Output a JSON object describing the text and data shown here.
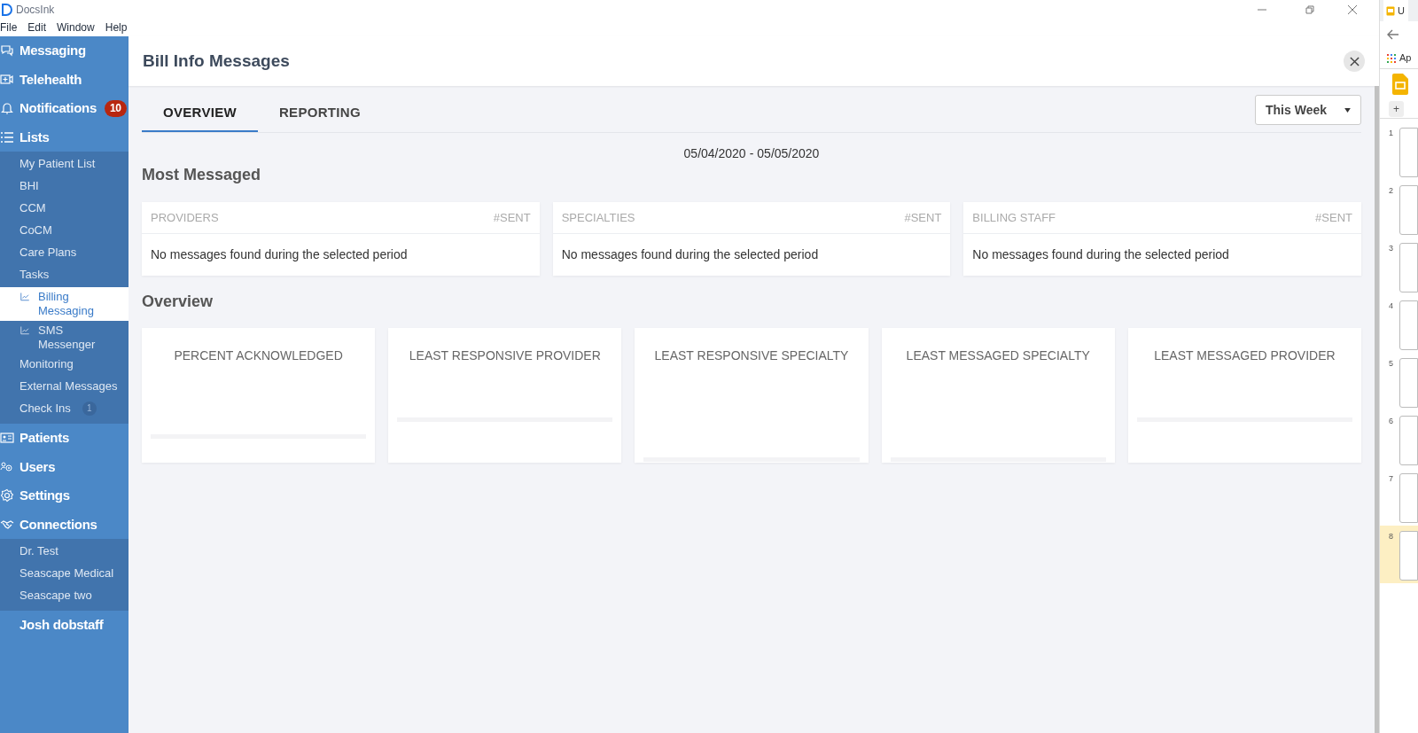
{
  "window": {
    "title": "DocsInk",
    "menu": [
      "File",
      "Edit",
      "Window",
      "Help"
    ]
  },
  "sidebar": {
    "items": [
      {
        "label": "Messaging"
      },
      {
        "label": "Telehealth"
      },
      {
        "label": "Notifications",
        "badge": "10"
      },
      {
        "label": "Lists",
        "children": [
          {
            "label": "My Patient List",
            "selected": false
          },
          {
            "label": "BHI",
            "selected": false
          },
          {
            "label": "CCM",
            "selected": false
          },
          {
            "label": "CoCM",
            "selected": false
          },
          {
            "label": "Care Plans",
            "selected": false
          },
          {
            "label": "Tasks",
            "selected": false
          },
          {
            "label": "Billing Messaging",
            "selected": true
          },
          {
            "label": "SMS Messenger",
            "selected": false
          },
          {
            "label": "Monitoring",
            "selected": false
          },
          {
            "label": "External Messages",
            "selected": false
          },
          {
            "label": "Check Ins",
            "selected": false,
            "badge": "1"
          }
        ]
      },
      {
        "label": "Patients"
      },
      {
        "label": "Users"
      },
      {
        "label": "Settings"
      },
      {
        "label": "Connections",
        "children": [
          {
            "label": "Dr. Test",
            "selected": false
          },
          {
            "label": "Seascape Medical",
            "selected": false
          },
          {
            "label": "Seascape two",
            "selected": false
          }
        ]
      },
      {
        "label": "Josh dobstaff"
      }
    ]
  },
  "page": {
    "title": "Bill Info Messages",
    "tabs": [
      {
        "label": "OVERVIEW",
        "selected": true
      },
      {
        "label": "REPORTING",
        "selected": false
      }
    ],
    "period": "This Week",
    "date_range": {
      "from": "05/04/2020",
      "separator": "-",
      "to": "05/05/2020"
    },
    "most_messaged": {
      "title": "Most Messaged",
      "cards": [
        {
          "heading": "PROVIDERS",
          "count_label": "#SENT",
          "message": "No messages found during the selected period"
        },
        {
          "heading": "SPECIALTIES",
          "count_label": "#SENT",
          "message": "No messages found during the selected period"
        },
        {
          "heading": "BILLING STAFF",
          "count_label": "#SENT",
          "message": "No messages found during the selected period"
        }
      ]
    },
    "overview": {
      "title": "Overview",
      "cards": [
        "PERCENT ACKNOWLEDGED",
        "LEAST RESPONSIVE PROVIDER",
        "LEAST RESPONSIVE SPECIALTY",
        "LEAST MESSAGED SPECIALTY",
        "LEAST MESSAGED PROVIDER"
      ]
    }
  },
  "browser": {
    "tab_title": "U",
    "bookmark": "Ap",
    "toolbar_button": "+",
    "slides": [
      {
        "number": "1",
        "selected": false
      },
      {
        "number": "2",
        "selected": false
      },
      {
        "number": "3",
        "selected": false
      },
      {
        "number": "4",
        "selected": false
      },
      {
        "number": "5",
        "selected": false
      },
      {
        "number": "6",
        "selected": false
      },
      {
        "number": "7",
        "selected": false
      },
      {
        "number": "8",
        "selected": true
      }
    ]
  }
}
